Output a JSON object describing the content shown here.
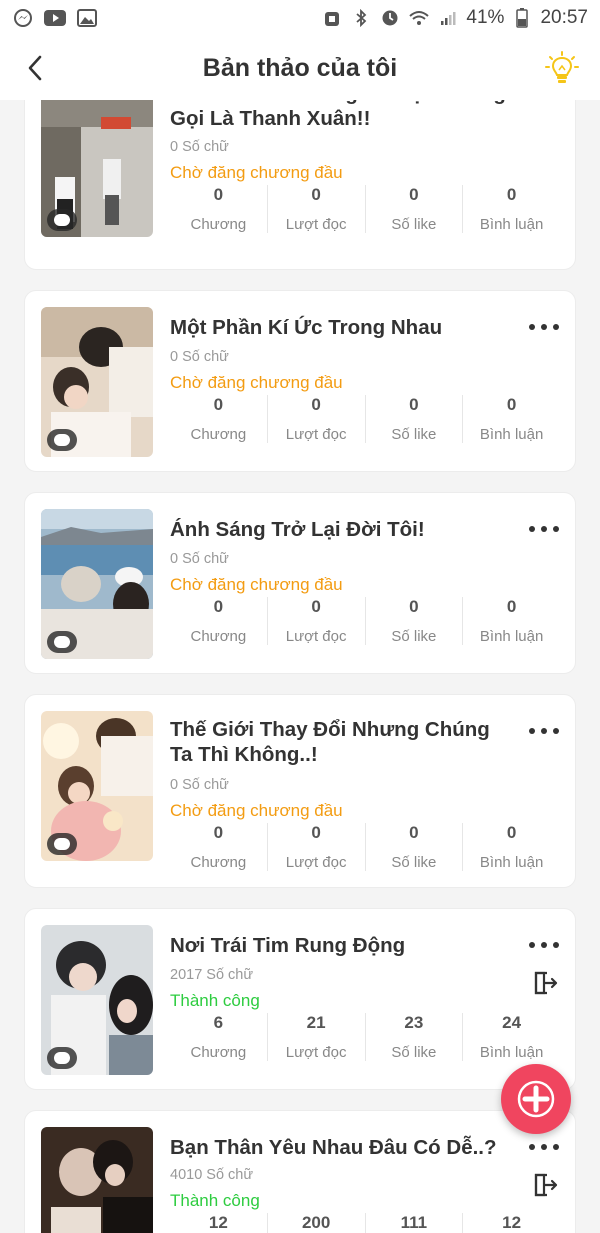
{
  "status_bar": {
    "battery": "41%",
    "time": "20:57",
    "left_icons": [
      "messenger-icon",
      "youtube-icon",
      "gallery-icon"
    ],
    "right_icons": [
      "alarm-icon",
      "bluetooth-icon",
      "clock-icon",
      "wifi-icon",
      "signal-icon",
      "battery-icon"
    ]
  },
  "header": {
    "title": "Bản thảo của tôi",
    "back_icon": "chevron-left-icon",
    "tip_icon": "lightbulb-icon"
  },
  "stat_labels": {
    "chapters": "Chương",
    "reads": "Lượt đọc",
    "likes": "Số like",
    "comments": "Bình luận"
  },
  "stories": [
    {
      "title": "Thanh Xuân Không Có Cậu Không Gọi Là Thanh Xuân!!",
      "words": "0 Số chữ",
      "status": "Chờ đăng chương đầu",
      "status_type": "pending",
      "stats": {
        "chapters": "0",
        "reads": "0",
        "likes": "0",
        "comments": "0"
      }
    },
    {
      "title": "Một Phần Kí Ức Trong Nhau",
      "words": "0 Số chữ",
      "status": "Chờ đăng chương đầu",
      "status_type": "pending",
      "stats": {
        "chapters": "0",
        "reads": "0",
        "likes": "0",
        "comments": "0"
      }
    },
    {
      "title": "Ánh Sáng Trở Lại Đời Tôi!",
      "words": "0 Số chữ",
      "status": "Chờ đăng chương đầu",
      "status_type": "pending",
      "stats": {
        "chapters": "0",
        "reads": "0",
        "likes": "0",
        "comments": "0"
      }
    },
    {
      "title": "Thế Giới Thay Đổi Nhưng Chúng Ta Thì Không..!",
      "words": "0 Số chữ",
      "status": "Chờ đăng chương đầu",
      "status_type": "pending",
      "stats": {
        "chapters": "0",
        "reads": "0",
        "likes": "0",
        "comments": "0"
      }
    },
    {
      "title": "Nơi Trái Tim Rung Động",
      "words": "2017 Số chữ",
      "status": "Thành công",
      "status_type": "success",
      "stats": {
        "chapters": "6",
        "reads": "21",
        "likes": "23",
        "comments": "24"
      }
    },
    {
      "title": "Bạn Thân Yêu Nhau Đâu Có Dễ..?",
      "words": "4010 Số chữ",
      "status": "Thành công",
      "status_type": "success",
      "stats": {
        "chapters": "12",
        "reads": "200",
        "likes": "111",
        "comments": "12"
      }
    }
  ],
  "fab_icon": "plus-icon",
  "colors": {
    "pending": "#f39c12",
    "success": "#2ecc40",
    "fab": "#f0455f",
    "bulb": "#f5c518"
  }
}
